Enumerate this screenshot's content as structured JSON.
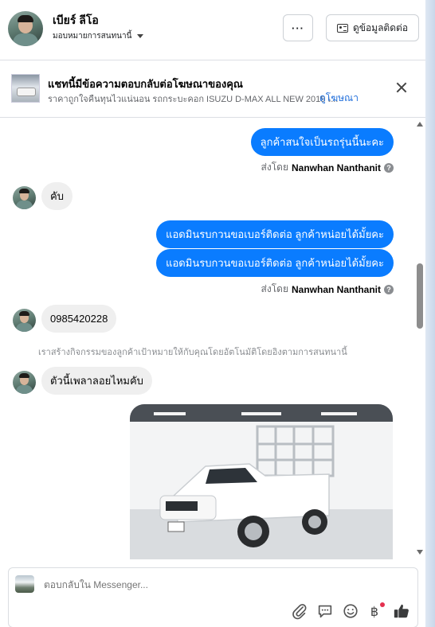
{
  "header": {
    "contact_name": "เบียร์ ลีโอ",
    "assign_label": "มอบหมายการสนทนานี้",
    "more_label": "···",
    "contact_info_label": "ดูข้อมูลติดต่อ"
  },
  "ad_banner": {
    "title": "แชทนี้มีข้อความตอบกลับต่อโฆษณาของคุณ",
    "subtitle": "ราคาถูกใจคืนทุนไวแน่นอน รถกระบะคอก ISUZU D-MAX ALL NEW 2019 เ...",
    "link_label": "ดูโฆษณา"
  },
  "messages": {
    "m1": "ลูกค้าสนใจเป็นรถรุ่นนี้นะคะ",
    "m2": "คับ",
    "m3": "แอดมินรบกวนขอเบอร์ติดต่อ ลูกค้าหน่อยได้มั้ยคะ",
    "m4": "แอดมินรบกวนขอเบอร์ติดต่อ ลูกค้าหน่อยได้มั้ยคะ",
    "m5": "0985420228",
    "m6": "ตัวนี้เพลาลอยไหมคับ"
  },
  "sent_by": {
    "prefix": "ส่งโดย",
    "name": "Nanwhan Nanthanit"
  },
  "system_note": "เราสร้างกิจกรรมของลูกค้าเป้าหมายให้กับคุณโดยอัตโนมัติโดยอิงตามการสนทนานี้",
  "composer": {
    "placeholder": "ตอบกลับใน Messenger..."
  },
  "colors": {
    "outgoing_bubble": "#0a7cff",
    "incoming_bubble": "#efefef",
    "link": "#216fdb",
    "like": "#0a7cff"
  },
  "icons": {
    "attach": "paperclip-icon",
    "saved_replies": "speech-bubble-icon",
    "emoji": "smiley-icon",
    "payment": "baht-icon",
    "like": "thumbs-up-icon"
  }
}
